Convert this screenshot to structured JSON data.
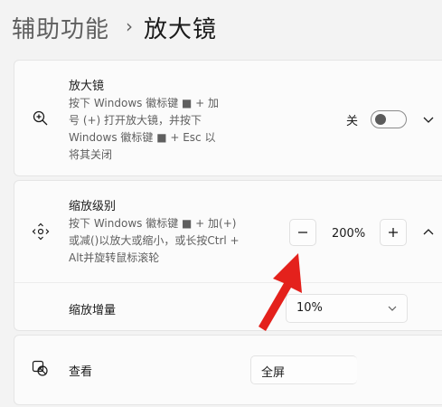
{
  "breadcrumb": {
    "parent": "辅助功能",
    "separator": "›",
    "current": "放大镜"
  },
  "magnifier_card": {
    "icon": "magnifier-icon",
    "title": "放大镜",
    "description_lines": [
      "按下 Windows 徽标键 ■ + 加",
      "号 (+) 打开放大镜，并按下",
      "Windows 徽标键 ■ + Esc 以",
      "将其关闭"
    ],
    "toggle_label": "关",
    "toggle_on": false
  },
  "zoom_card": {
    "icon": "zoom-level-icon",
    "title": "缩放级别",
    "description_lines": [
      "按下 Windows 徽标键 ■ + 加(+)",
      "或减()以放大或缩小，或长按Ctrl +",
      "Alt并旋转鼠标滚轮"
    ],
    "zoom_value": "200%",
    "increment_label": "缩放增量",
    "increment_value": "10%"
  },
  "view_card": {
    "icon": "view-icon",
    "label": "查看",
    "value": "全屏"
  }
}
